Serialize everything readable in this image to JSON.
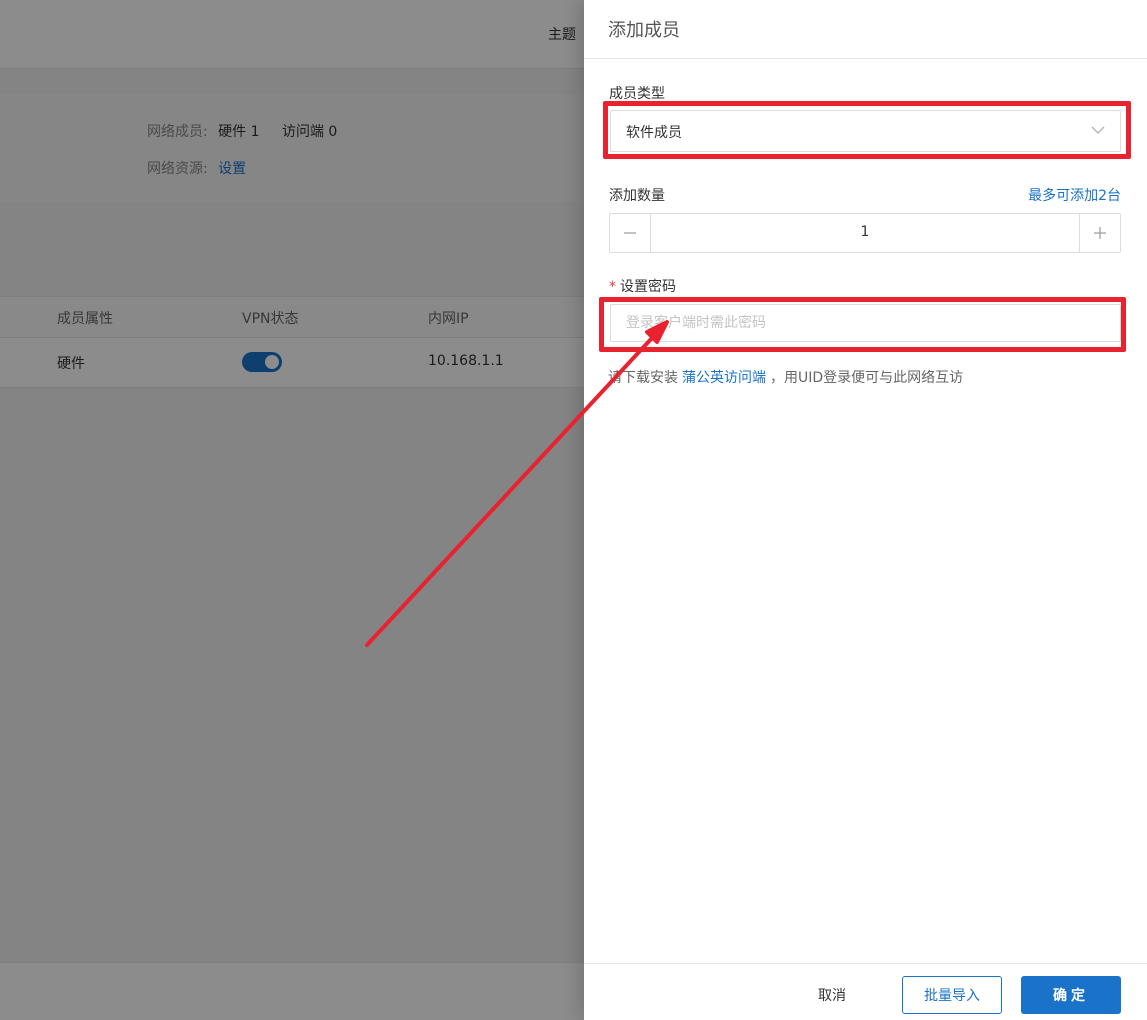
{
  "background": {
    "topbar_text": "主题",
    "info": {
      "members_label": "网络成员:",
      "hardware": "硬件 1",
      "access": "访问端 0",
      "resources_label": "网络资源:",
      "resources_link": "设置"
    },
    "table": {
      "headers": [
        "成员属性",
        "VPN状态",
        "内网IP"
      ],
      "row": {
        "attribute": "硬件",
        "vpn_enabled": true,
        "ip": "10.168.1.1"
      }
    }
  },
  "drawer": {
    "title": "添加成员",
    "member_type": {
      "label": "成员类型",
      "value": "软件成员"
    },
    "quantity": {
      "label": "添加数量",
      "limit_link": "最多可添加2台",
      "value": "1"
    },
    "password": {
      "label": "设置密码",
      "required_mark": "*",
      "placeholder": "登录客户端时需此密码"
    },
    "hint": {
      "prefix": "请下载安装",
      "link": "蒲公英访问端",
      "suffix": "，用UID登录便可与此网络互访"
    },
    "footer": {
      "cancel": "取消",
      "import": "批量导入",
      "ok": "确定"
    }
  },
  "colors": {
    "accent": "#1a73c8",
    "annotation": "#e8232f"
  },
  "icons": {
    "select": "chevron-down-icon",
    "minus": "minus-icon",
    "plus": "plus-icon"
  }
}
